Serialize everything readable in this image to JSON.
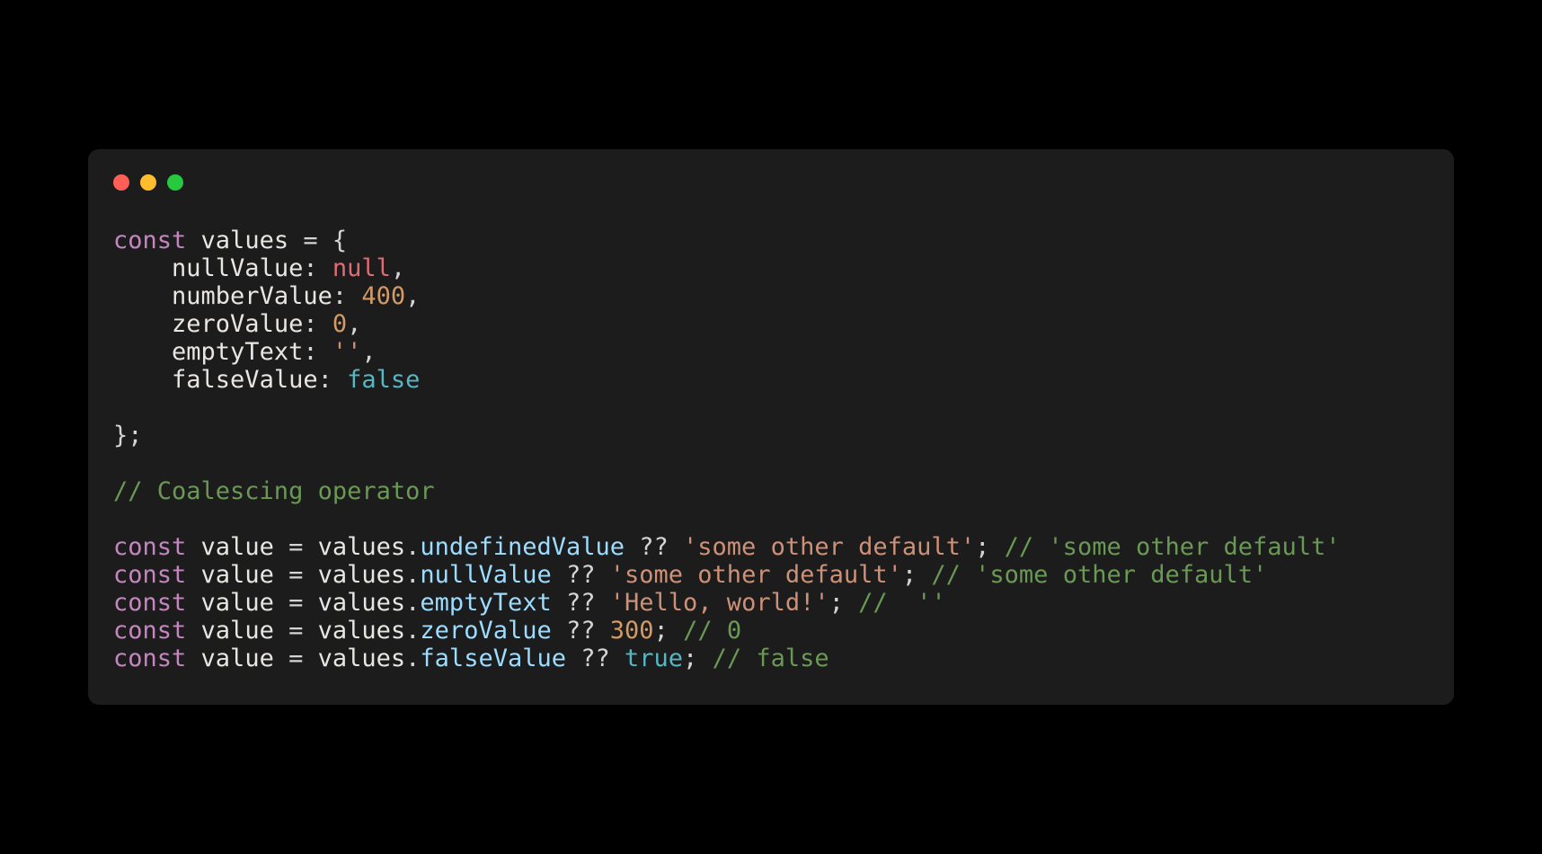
{
  "colors": {
    "bg": "#000000",
    "window": "#1c1c1c",
    "traffic_red": "#ff5f56",
    "traffic_yellow": "#ffbd2e",
    "traffic_green": "#27c93f",
    "keyword": "#c586c0",
    "text": "#e8e6e3",
    "null": "#e06c75",
    "number": "#d19a66",
    "string": "#ce9178",
    "bool": "#56b6c2",
    "comment": "#6a9955",
    "member": "#9cdcfe"
  },
  "code": {
    "kw_const": "const",
    "var_values": "values",
    "eq": " = ",
    "brace_open": "{",
    "brace_close_semi": "};",
    "indent": "    ",
    "colon_sp": ": ",
    "comma": ",",
    "props": {
      "nullValue": "nullValue",
      "numberValue": "numberValue",
      "zeroValue": "zeroValue",
      "emptyText": "emptyText",
      "falseValue": "falseValue"
    },
    "vals": {
      "null": "null",
      "n400": "400",
      "n0": "0",
      "empty_str": "''",
      "false": "false"
    },
    "comment_header": "// Coalescing operator",
    "var_value": "value",
    "dot": ".",
    "coalesce": " ?? ",
    "semi": ";",
    "true": "true",
    "n300": "300",
    "members": {
      "undefinedValue": "undefinedValue",
      "nullValue": "nullValue",
      "emptyText": "emptyText",
      "zeroValue": "zeroValue",
      "falseValue": "falseValue"
    },
    "strings": {
      "some_other_default": "'some other default'",
      "hello_world": "'Hello, world!'"
    },
    "comments": {
      "some_other_default": " // 'some other default'",
      "empty": " //  ''",
      "zero": " // 0",
      "false": " // false"
    }
  }
}
